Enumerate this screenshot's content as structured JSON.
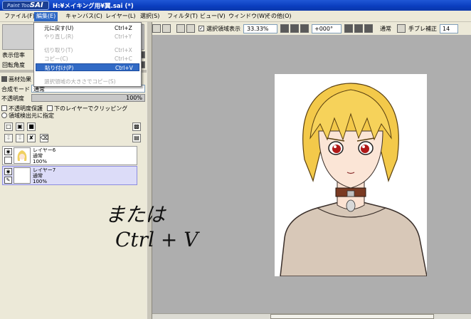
{
  "window": {
    "logo_small": "Paint Tool",
    "logo_big": "SAI",
    "title": "H:¥メイキング用¥翼.sai (*)"
  },
  "menubar": [
    {
      "label": "ファイル(F)"
    },
    {
      "label": "編集(E)"
    },
    {
      "label": "キャンバス(C)"
    },
    {
      "label": "レイヤー(L)"
    },
    {
      "label": "選択(S)"
    },
    {
      "label": "フィルタ(T)"
    },
    {
      "label": "ビュー(V)"
    },
    {
      "label": "ウィンドウ(W)"
    },
    {
      "label": "その他(O)"
    }
  ],
  "edit_menu": {
    "items": [
      {
        "label": "元に戻す(U)",
        "shortcut": "Ctrl+Z"
      },
      {
        "label": "やり直し(R)",
        "shortcut": "Ctrl+Y"
      },
      {
        "label": "切り取り(T)",
        "shortcut": "Ctrl+X"
      },
      {
        "label": "コピー(C)",
        "shortcut": "Ctrl+C"
      },
      {
        "label": "貼り付け(P)",
        "shortcut": "Ctrl+V"
      },
      {
        "label": "選択領域の大きさでコピー(S)",
        "shortcut": ""
      }
    ]
  },
  "toolbar": {
    "show_selection_label": "選択領域表示",
    "zoom": "33.33%",
    "rotation": "+000°",
    "blend": "通常",
    "stabilizer_label": "手ブレ補正",
    "stabilizer_value": "14"
  },
  "left_panel": {
    "nav_label": "表示倍率",
    "rotate_label": "回転角度",
    "paper_effect": "画材効果",
    "blend_mode_label": "合成モード",
    "blend_mode_value": "通常",
    "opacity_label": "不透明度",
    "opacity_value": "100%",
    "preserve_opacity": "不透明度保護",
    "clip_lower": "下のレイヤーでクリッピング",
    "selection_source": "領域検出元に指定"
  },
  "layers": [
    {
      "name": "レイヤー6",
      "mode": "通常",
      "opacity": "100%"
    },
    {
      "name": "レイヤー7",
      "mode": "通常",
      "opacity": "100%"
    }
  ],
  "colors": {
    "accent": "#316ac5",
    "titlebar": "#0a3cbe",
    "panel": "#ece9d8",
    "canvas_bg": "#aeaeae"
  },
  "annotation_lines": [
    "または",
    "Ctrl + V"
  ]
}
